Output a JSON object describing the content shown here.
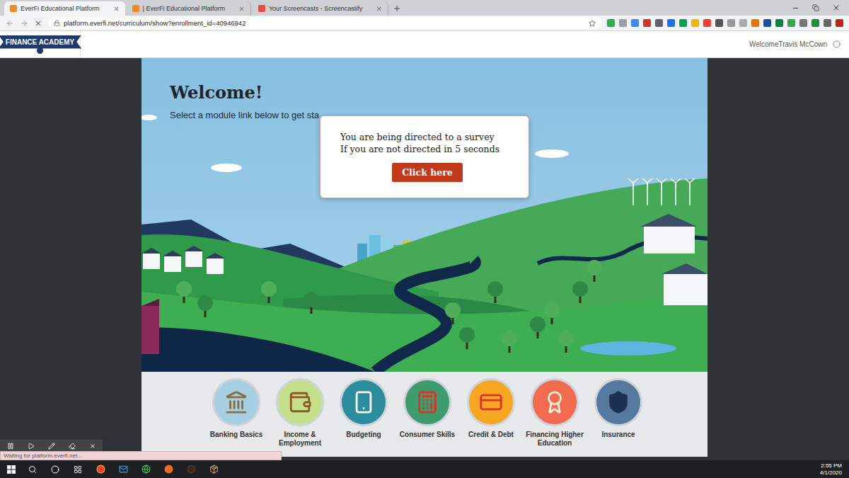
{
  "browser": {
    "tabs": [
      {
        "label": "EverFi Educational Platform",
        "selected": true
      },
      {
        "label": "| EverFi Educational Platform",
        "selected": false
      },
      {
        "label": "Your Screencasts - Screencastify",
        "selected": false
      }
    ],
    "address": "platform.everfi.net/curriculum/show?enrollment_id=40946942"
  },
  "header": {
    "logo": "FINANCE ACADEMY",
    "user": "WelcomeTravis McCown"
  },
  "hero": {
    "title": "Welcome!",
    "subtitle": "Select a module link below to get sta"
  },
  "dialog": {
    "lines": [
      "You are being directed to a survey",
      "If you are not directed in 5 seconds"
    ],
    "button": "Click here"
  },
  "modules": [
    {
      "label": "Banking Basics",
      "color": "#a7cfe3"
    },
    {
      "label": "Income & Employment",
      "color": "#c5e08a"
    },
    {
      "label": "Budgeting",
      "color": "#2b8c9b"
    },
    {
      "label": "Consumer Skills",
      "color": "#3d9b6e"
    },
    {
      "label": "Credit & Debt",
      "color": "#f6a623"
    },
    {
      "label": "Financing Higher Education",
      "color": "#f26a4f"
    },
    {
      "label": "Insurance",
      "color": "#55799d"
    }
  ],
  "status_bar": "Waiting for platform.everfi.net...",
  "taskbar": {
    "time": "2:55 PM",
    "date": "4/1/2020"
  }
}
